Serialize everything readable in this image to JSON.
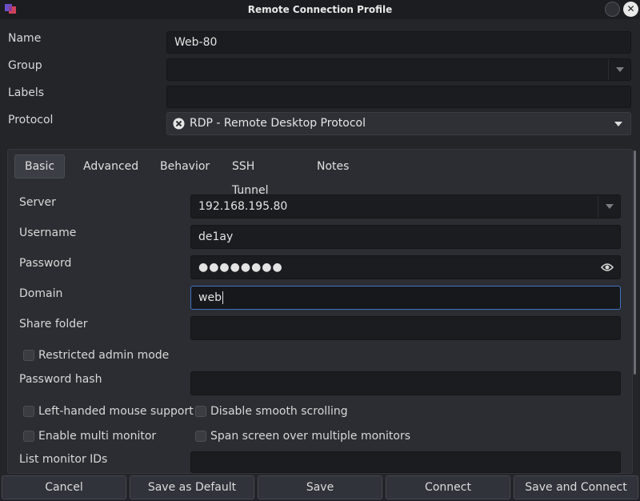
{
  "window": {
    "title": "Remote Connection Profile"
  },
  "form": {
    "name_label": "Name",
    "name_value": "Web-80",
    "group_label": "Group",
    "group_value": "",
    "labels_label": "Labels",
    "labels_value": "",
    "protocol_label": "Protocol",
    "protocol_value": "RDP - Remote Desktop Protocol"
  },
  "tabs": [
    {
      "label": "Basic",
      "active": true
    },
    {
      "label": "Advanced",
      "active": false
    },
    {
      "label": "Behavior",
      "active": false
    },
    {
      "label": "SSH Tunnel",
      "active": false
    },
    {
      "label": "Notes",
      "active": false
    }
  ],
  "basic": {
    "server_label": "Server",
    "server_value": "192.168.195.80",
    "username_label": "Username",
    "username_value": "de1ay",
    "password_label": "Password",
    "password_value": "●●●●●●●●",
    "domain_label": "Domain",
    "domain_value": "web",
    "share_folder_label": "Share folder",
    "share_folder_value": "",
    "restricted_admin_label": "Restricted admin mode",
    "restricted_admin_checked": false,
    "password_hash_label": "Password hash",
    "password_hash_value": "",
    "left_handed_label": "Left-handed mouse support",
    "left_handed_checked": false,
    "disable_smooth_label": "Disable smooth scrolling",
    "disable_smooth_checked": false,
    "multi_monitor_label": "Enable multi monitor",
    "multi_monitor_checked": false,
    "span_screen_label": "Span screen over multiple monitors",
    "span_screen_checked": false,
    "monitor_ids_label": "List monitor IDs",
    "monitor_ids_value": ""
  },
  "buttons": {
    "cancel": "Cancel",
    "save_default": "Save as Default",
    "save": "Save",
    "connect": "Connect",
    "save_connect": "Save and Connect"
  },
  "icons": {
    "app": "remmina-app-icon",
    "protocol": "rdp-protocol-icon",
    "reveal_password": "eye-icon"
  },
  "colors": {
    "background": "#232529",
    "panel": "#2b2d32",
    "field": "#1b1c1f",
    "focus_border": "#3f72c4"
  }
}
